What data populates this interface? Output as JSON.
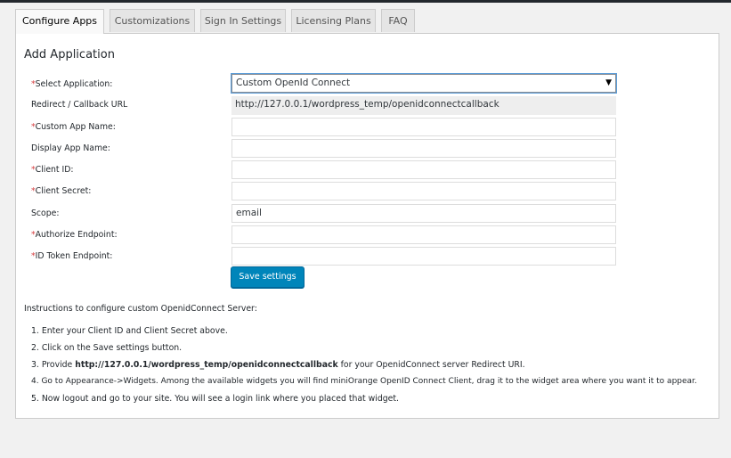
{
  "tabs": [
    {
      "label": "Configure Apps",
      "active": true
    },
    {
      "label": "Customizations",
      "active": false
    },
    {
      "label": "Sign In Settings",
      "active": false
    },
    {
      "label": "Licensing Plans",
      "active": false
    },
    {
      "label": "FAQ",
      "active": false
    }
  ],
  "panel": {
    "title": "Add Application"
  },
  "form": {
    "select_application": {
      "label": "Select Application:",
      "required": "*",
      "value": "Custom OpenId Connect"
    },
    "redirect_url": {
      "label": "Redirect / Callback URL",
      "value": "http://127.0.0.1/wordpress_temp/openidconnectcallback"
    },
    "custom_app_name": {
      "label": "Custom App Name:",
      "required": "*",
      "value": ""
    },
    "display_app_name": {
      "label": "Display App Name:",
      "value": ""
    },
    "client_id": {
      "label": "Client ID:",
      "required": "*",
      "value": ""
    },
    "client_secret": {
      "label": "Client Secret:",
      "required": "*",
      "value": ""
    },
    "scope": {
      "label": "Scope:",
      "value": "email"
    },
    "authorize_endpoint": {
      "label": "Authorize Endpoint:",
      "required": "*",
      "value": ""
    },
    "id_token_endpoint": {
      "label": "ID Token Endpoint:",
      "required": "*",
      "value": ""
    },
    "save_label": "Save settings"
  },
  "instructions": {
    "title": "Instructions to configure custom OpenidConnect Server:",
    "step1": "1. Enter your Client ID and Client Secret above.",
    "step2": "2. Click on the Save settings button.",
    "step3_pre": "3. Provide ",
    "step3_url": "http://127.0.0.1/wordpress_temp/openidconnectcallback",
    "step3_post": " for your OpenidConnect server Redirect URI.",
    "step4": "4. Go to Appearance->Widgets. Among the available widgets you will find miniOrange OpenID Connect Client, drag it to the widget area where you want it to appear.",
    "step5": "5. Now logout and go to your site. You will see a login link where you placed that widget."
  },
  "colors": {
    "primary_button": "#0085ba",
    "required_star": "#d63638",
    "page_background": "#f1f1f1"
  }
}
